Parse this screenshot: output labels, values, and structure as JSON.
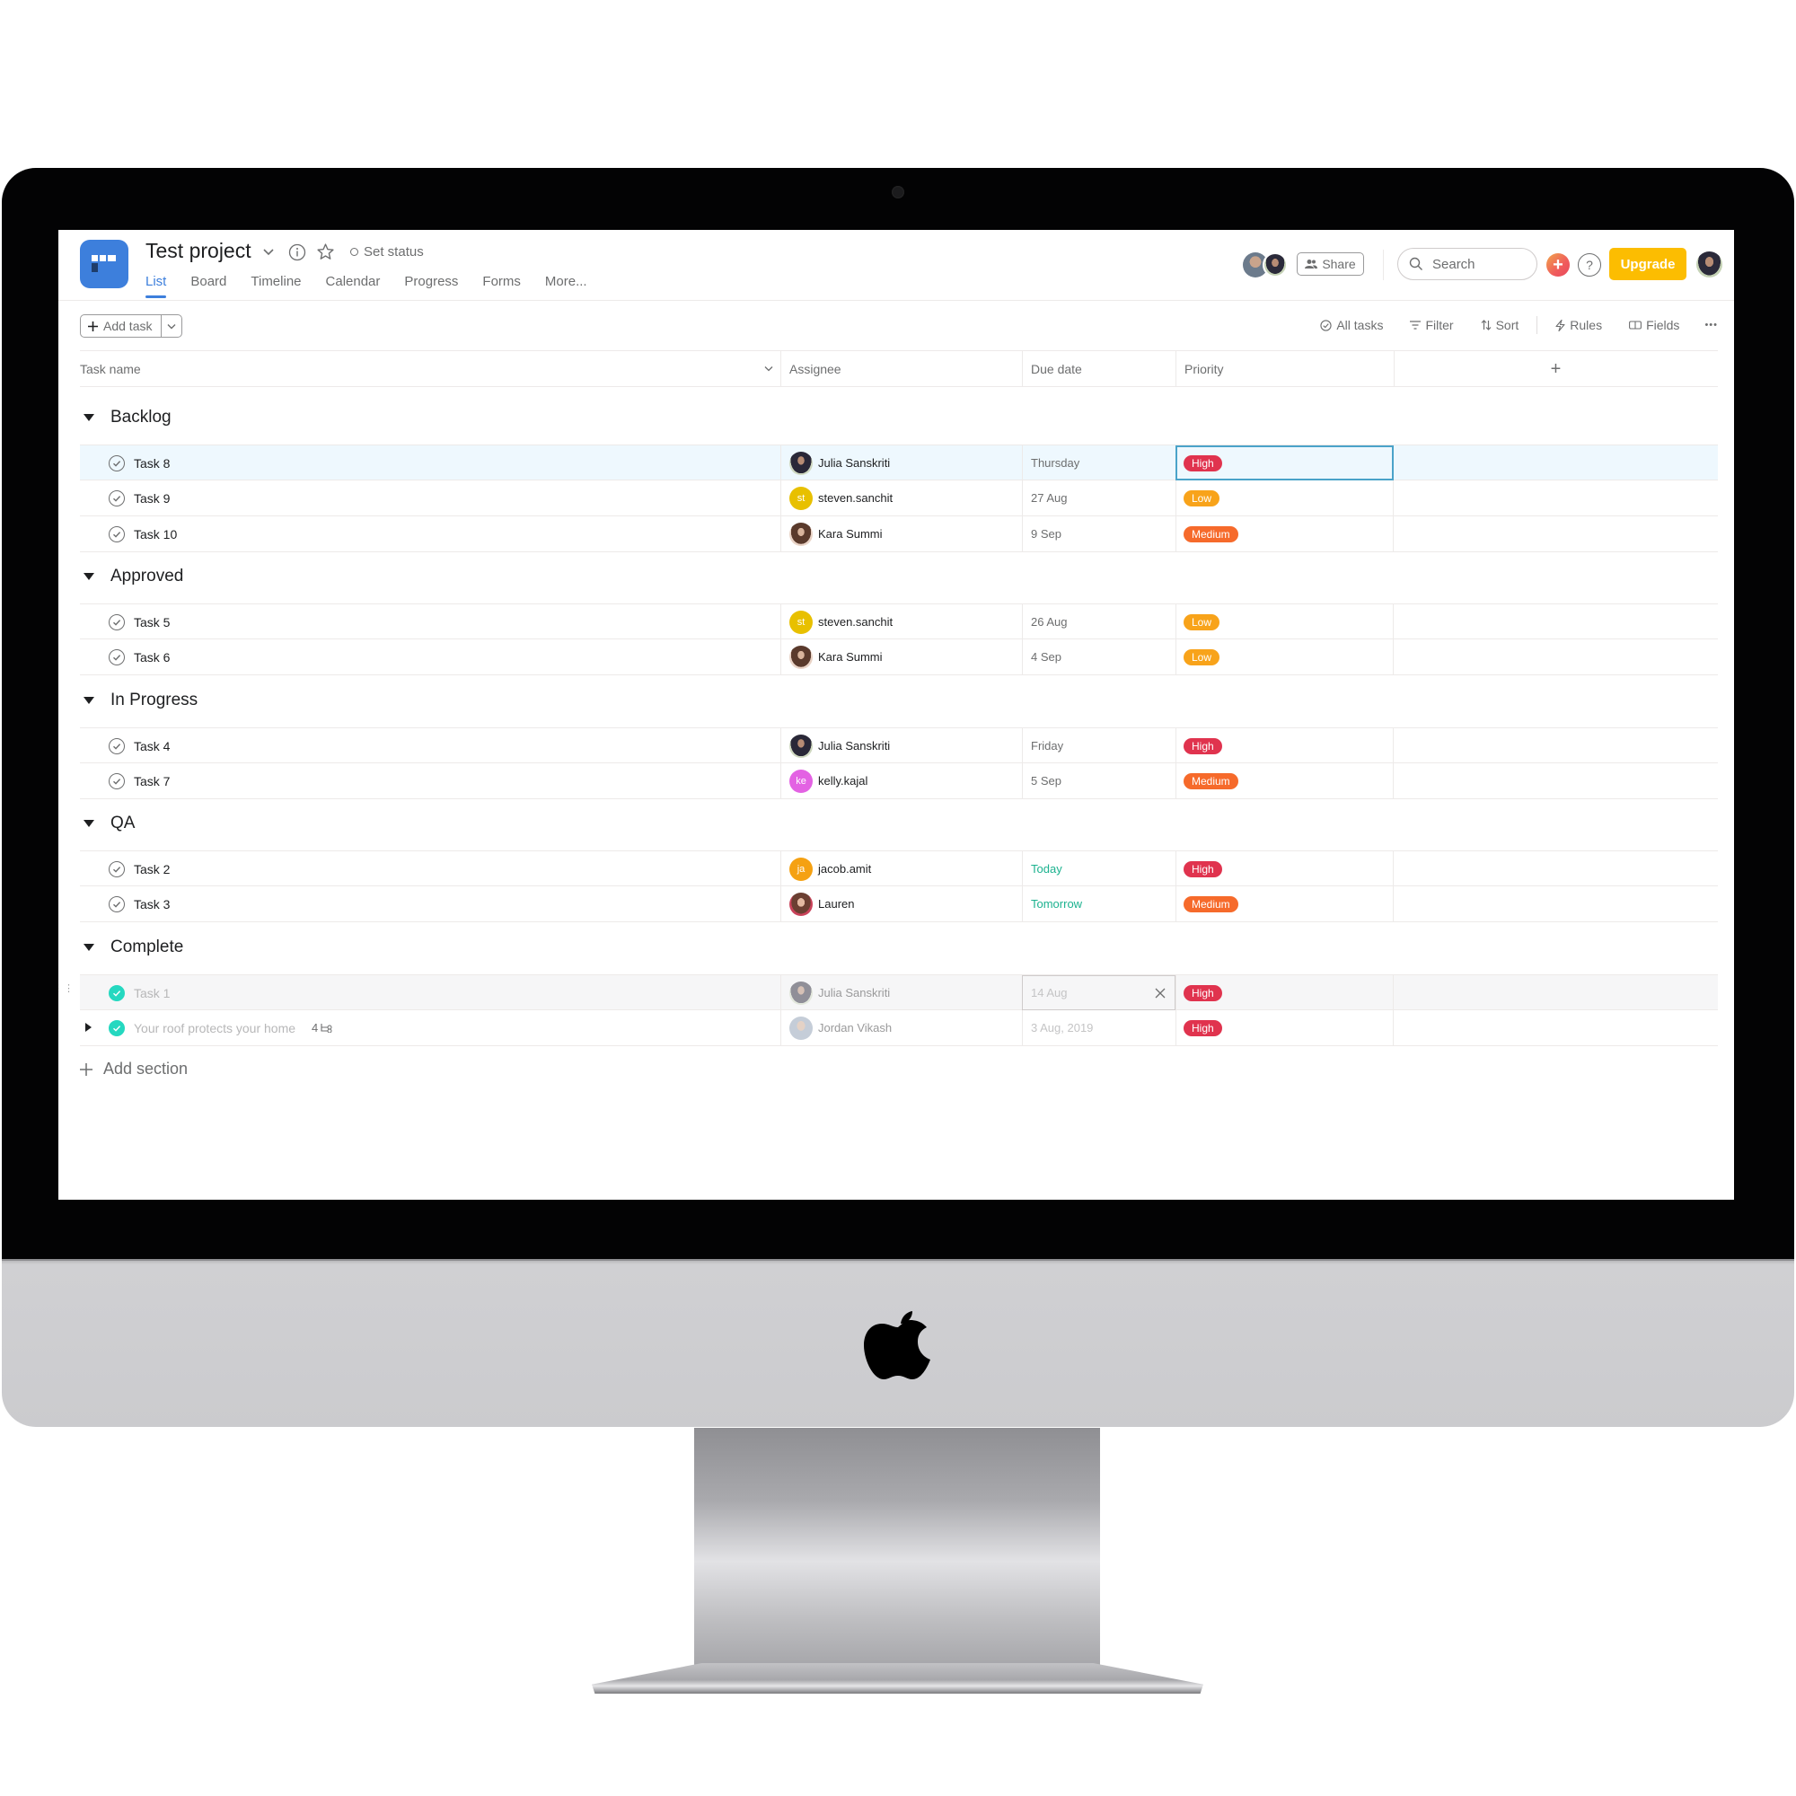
{
  "project": {
    "title": "Test project",
    "set_status": "Set status",
    "tabs": [
      {
        "label": "List",
        "active": true
      },
      {
        "label": "Board",
        "active": false
      },
      {
        "label": "Timeline",
        "active": false
      },
      {
        "label": "Calendar",
        "active": false
      },
      {
        "label": "Progress",
        "active": false
      },
      {
        "label": "Forms",
        "active": false
      },
      {
        "label": "More...",
        "active": false
      }
    ]
  },
  "header_right": {
    "share_label": "Share",
    "search_placeholder": "Search",
    "add_label": "+",
    "help_label": "?",
    "upgrade_label": "Upgrade"
  },
  "toolbar": {
    "add_task_label": "Add task",
    "all_tasks_label": "All tasks",
    "filter_label": "Filter",
    "sort_label": "Sort",
    "rules_label": "Rules",
    "fields_label": "Fields",
    "more_label": "•••"
  },
  "columns": {
    "task_name": "Task name",
    "assignee": "Assignee",
    "due_date": "Due date",
    "priority": "Priority",
    "add_column": "+"
  },
  "colors": {
    "accent": "#3d7fdc",
    "high": "#e0334e",
    "medium": "#f66a2b",
    "low": "#f8a31a",
    "upgrade": "#fcbd01",
    "complete_check": "#25d8c0",
    "due_soon": "#1cb28f"
  },
  "sections": [
    {
      "name": "Backlog",
      "tasks": [
        {
          "name": "Task 8",
          "assignee": "Julia Sanskriti",
          "avatar": "photo-julia",
          "due": "Thursday",
          "priority": "High"
        },
        {
          "name": "Task 9",
          "assignee": "steven.sanchit",
          "avatar_initials": "st",
          "avatar_color": "#e8c000",
          "due": "27 Aug",
          "priority": "Low"
        },
        {
          "name": "Task 10",
          "assignee": "Kara Summi",
          "avatar": "photo-kara",
          "due": "9 Sep",
          "priority": "Medium"
        }
      ]
    },
    {
      "name": "Approved",
      "tasks": [
        {
          "name": "Task 5",
          "assignee": "steven.sanchit",
          "avatar_initials": "st",
          "avatar_color": "#e8c000",
          "due": "26 Aug",
          "priority": "Low"
        },
        {
          "name": "Task 6",
          "assignee": "Kara Summi",
          "avatar": "photo-kara",
          "due": "4 Sep",
          "priority": "Low"
        }
      ]
    },
    {
      "name": "In Progress",
      "tasks": [
        {
          "name": "Task 4",
          "assignee": "Julia Sanskriti",
          "avatar": "photo-julia",
          "due": "Friday",
          "priority": "High"
        },
        {
          "name": "Task 7",
          "assignee": "kelly.kajal",
          "avatar_initials": "ke",
          "avatar_color": "#e362e3",
          "due": "5 Sep",
          "priority": "Medium"
        }
      ]
    },
    {
      "name": "QA",
      "tasks": [
        {
          "name": "Task 2",
          "assignee": "jacob.amit",
          "avatar_initials": "ja",
          "avatar_color": "#f5a112",
          "due": "Today",
          "priority": "High"
        },
        {
          "name": "Task 3",
          "assignee": "Lauren",
          "avatar": "photo-lauren",
          "due": "Tomorrow",
          "priority": "Medium"
        }
      ]
    },
    {
      "name": "Complete",
      "tasks": [
        {
          "name": "Task 1",
          "assignee": "Julia Sanskriti",
          "avatar": "photo-julia",
          "due": "14 Aug",
          "priority": "High",
          "completed": true
        },
        {
          "name": "Your roof protects your home",
          "subtask_count": "4",
          "assignee": "Jordan Vikash",
          "avatar": "photo-jordan",
          "due": "3 Aug, 2019",
          "priority": "High",
          "completed": true
        }
      ]
    }
  ],
  "add_section_label": "Add section"
}
